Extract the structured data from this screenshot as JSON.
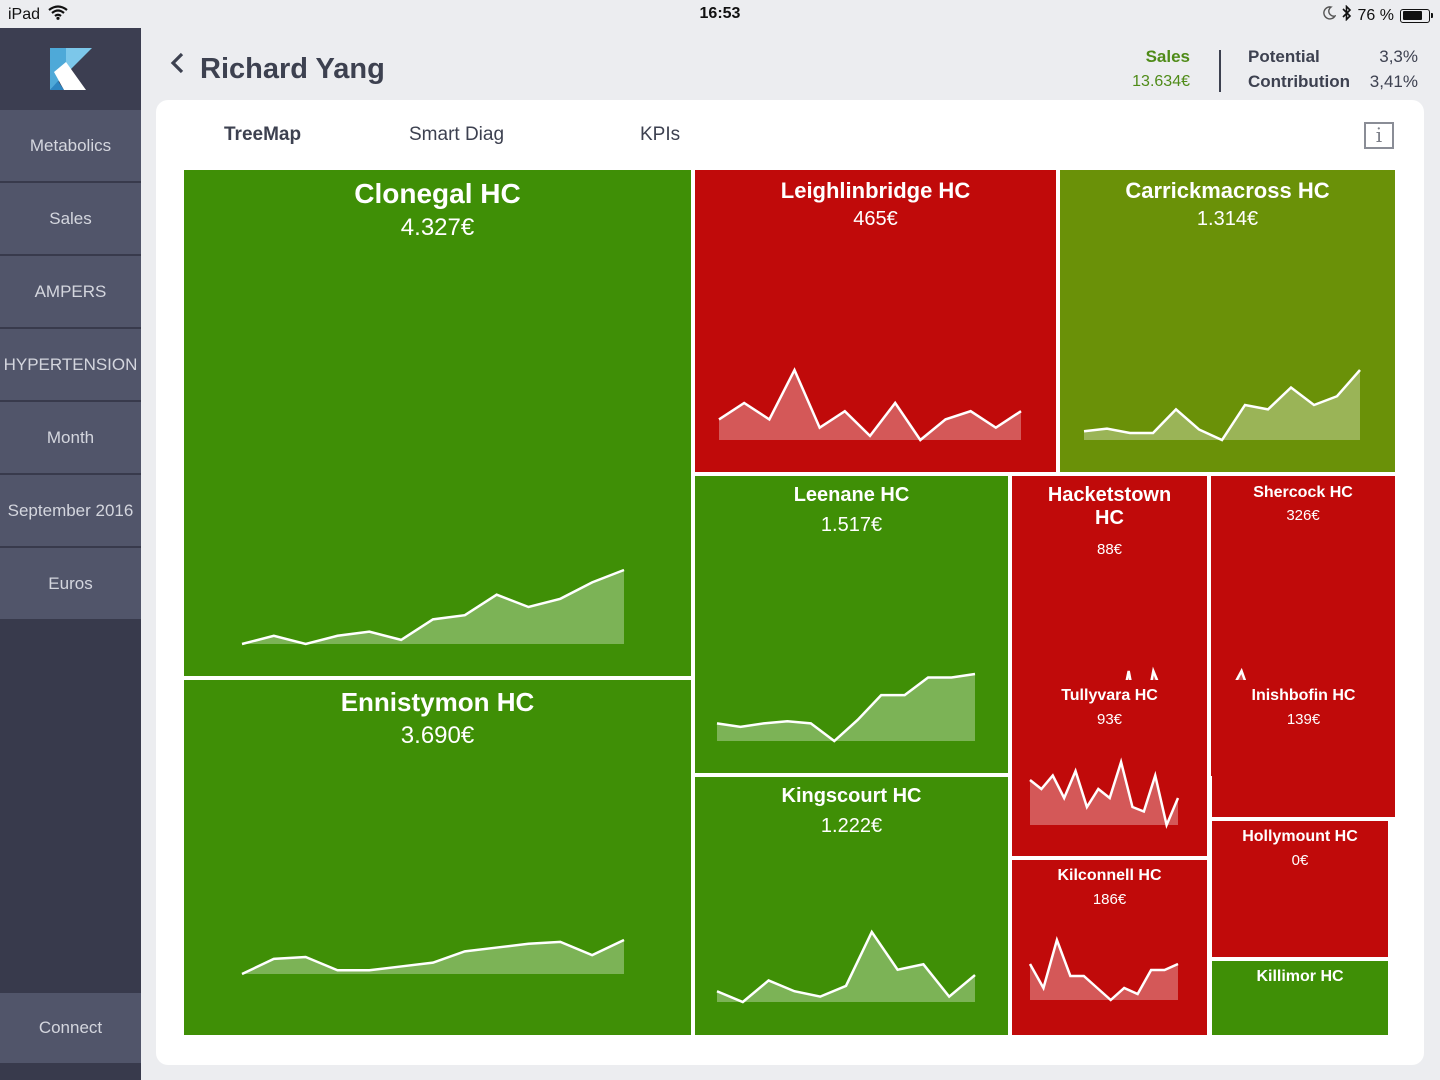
{
  "status_bar": {
    "device": "iPad",
    "time": "16:53",
    "battery": "76 %",
    "battery_level": 0.76
  },
  "sidebar": {
    "items": [
      {
        "label": "Metabolics"
      },
      {
        "label": "Sales"
      },
      {
        "label": "AMPERS"
      },
      {
        "label": "HYPERTENSION"
      },
      {
        "label": "Month"
      },
      {
        "label": "September 2016"
      },
      {
        "label": "Euros"
      }
    ],
    "connect_label": "Connect"
  },
  "header": {
    "back_icon": "chevron-left-icon",
    "title": "Richard Yang",
    "sales_label": "Sales",
    "sales_value": "13.634€",
    "potential_label": "Potential",
    "potential_value": "3,3%",
    "contribution_label": "Contribution",
    "contribution_value": "3,41%"
  },
  "tabs": [
    {
      "label": "TreeMap",
      "active": true
    },
    {
      "label": "Smart Diag",
      "active": false
    },
    {
      "label": "KPIs",
      "active": false
    }
  ],
  "info_label": "i",
  "colors": {
    "green": "#3f8f06",
    "olive": "#6a9108",
    "red": "#c00a0a",
    "sidebar": "#383a4c"
  },
  "treemap": {
    "tiles": [
      {
        "name": "Clonegal HC",
        "value": "4.327€",
        "status": "green",
        "spark": [
          2,
          3,
          2,
          3,
          3.5,
          2.5,
          5,
          5.5,
          8,
          6.5,
          7.5,
          9.5,
          11
        ]
      },
      {
        "name": "Ennistymon HC",
        "value": "3.690€",
        "status": "green",
        "spark": [
          1,
          5,
          5.5,
          2,
          2,
          3,
          4,
          7,
          8,
          9,
          9.5,
          6,
          10
        ]
      },
      {
        "name": "Leighlinbridge HC",
        "value": "465€",
        "status": "red",
        "spark": [
          3,
          5,
          3,
          9,
          2,
          4,
          1,
          5,
          0.5,
          3,
          4,
          2,
          4
        ]
      },
      {
        "name": "Carrickmacross HC",
        "value": "1.314€",
        "status": "olive",
        "spark": [
          1,
          1.3,
          0.8,
          0.8,
          3.5,
          1.2,
          0,
          4,
          3.5,
          6,
          4,
          5,
          8
        ]
      },
      {
        "name": "Leenane HC",
        "value": "1.517€",
        "status": "green",
        "spark": [
          2.5,
          2,
          2.5,
          2.8,
          2.5,
          0,
          3,
          6.5,
          6.5,
          9,
          9,
          9.5
        ]
      },
      {
        "name": "Kingscourt HC",
        "value": "1.222€",
        "status": "green",
        "spark": [
          1.5,
          0.5,
          2.5,
          1.5,
          1,
          2,
          7,
          3.5,
          4,
          1,
          3
        ]
      },
      {
        "name": "Hacketstown HC",
        "value": "88€",
        "status": "red",
        "spark": [
          5,
          1,
          4,
          0.5,
          3,
          0,
          6,
          1,
          7,
          0.5,
          7,
          4,
          1
        ]
      },
      {
        "name": "Shercock HC",
        "value": "326€",
        "status": "red",
        "spark": [
          4,
          6,
          3,
          0,
          4,
          1,
          3,
          0.5,
          2.5,
          1,
          3.5,
          1.5
        ]
      },
      {
        "name": "Tullyvara HC",
        "value": "93€",
        "status": "red",
        "spark": [
          5,
          4,
          5.5,
          3,
          6,
          2,
          4,
          3,
          7,
          2,
          1.5,
          5.5,
          0,
          3
        ]
      },
      {
        "name": "Inishbofin HC",
        "value": "139€",
        "status": "red",
        "spark": []
      },
      {
        "name": "Kilconnell HC",
        "value": "186€",
        "status": "red",
        "spark": [
          3,
          1,
          5,
          2,
          2,
          1,
          0,
          1,
          0.5,
          2.5,
          2.5,
          3
        ]
      },
      {
        "name": "Hollymount HC",
        "value": "0€",
        "status": "red",
        "spark": []
      },
      {
        "name": "Killimor HC",
        "value": "",
        "status": "green",
        "spark": []
      }
    ]
  }
}
